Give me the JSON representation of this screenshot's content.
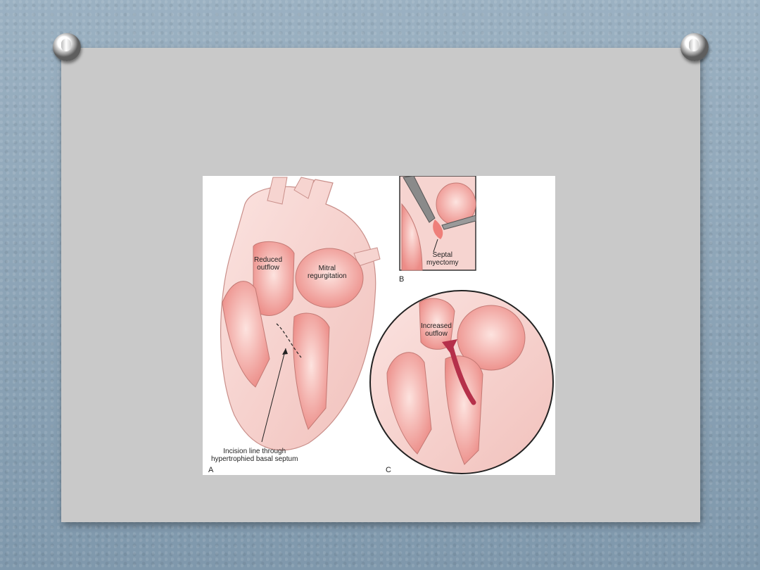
{
  "figure": {
    "labels": {
      "reduced_outflow_1": "Reduced",
      "reduced_outflow_2": "outflow",
      "mitral_1": "Mitral",
      "mitral_2": "regurgitation",
      "septal_1": "Septal",
      "septal_2": "myectomy",
      "increased_1": "Increased",
      "increased_2": "outflow",
      "incision_1": "Incision line through",
      "incision_2": "hypertrophied basal septum"
    },
    "panels": {
      "a": "A",
      "b": "B",
      "c": "C"
    }
  },
  "colors": {
    "slide_background": "#8ea6b8",
    "board": "#c9c9c9",
    "tissue": "#f3c7c2",
    "tissue_dark": "#e89a94",
    "chamber": "#ef8f8a",
    "arrow": "#b5304a"
  }
}
